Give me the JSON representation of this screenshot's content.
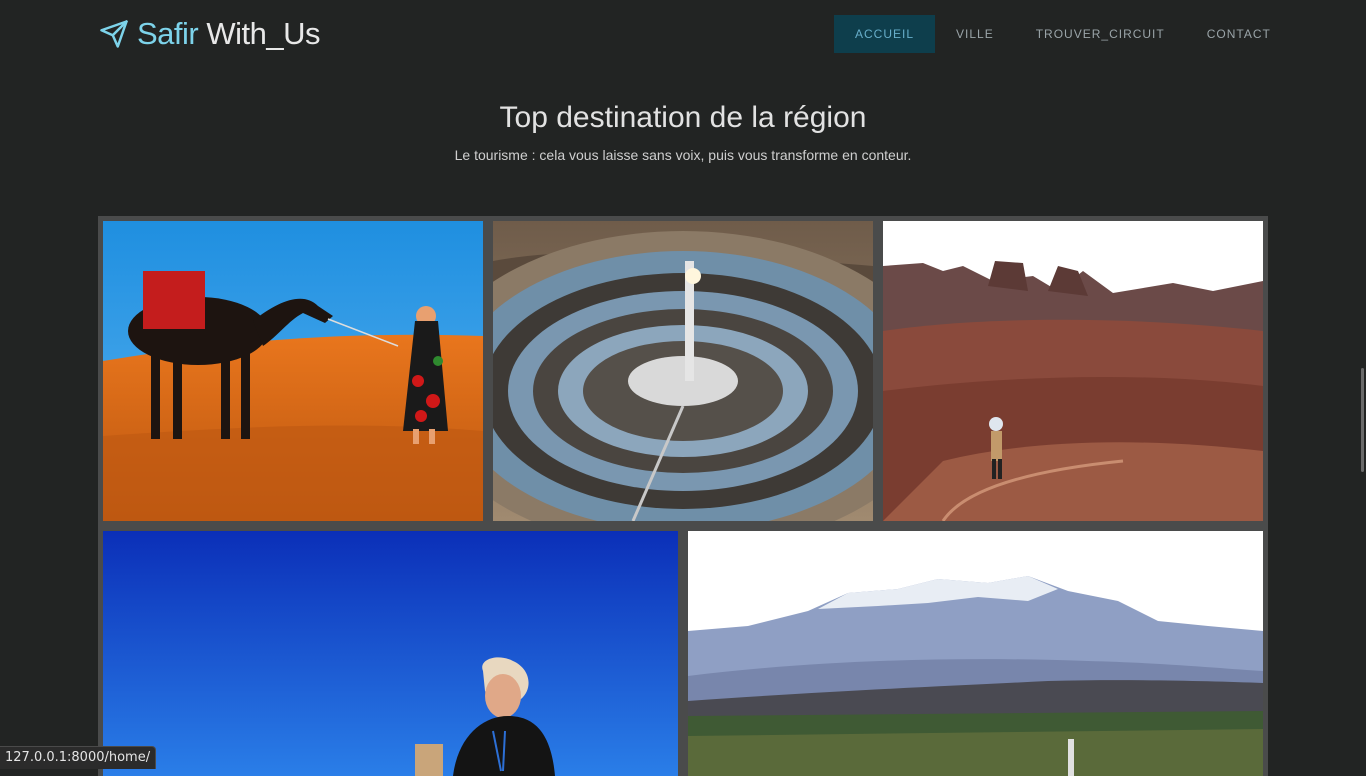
{
  "brand": {
    "accent": "Safir",
    "rest": " With_Us",
    "icon": "paper-plane-icon"
  },
  "nav": {
    "items": [
      {
        "label": "ACCUEIL",
        "active": true
      },
      {
        "label": "VILLE",
        "active": false
      },
      {
        "label": "TROUVER_CIRCUIT",
        "active": false
      },
      {
        "label": "CONTACT",
        "active": false
      }
    ]
  },
  "hero": {
    "title": "Top destination de la région",
    "subtitle": "Le tourisme : cela vous laisse sans voix, puis vous transforme en conteur."
  },
  "gallery": {
    "photos": [
      "desert-camel",
      "solar-tower",
      "red-rock-canyon",
      "woman-blue-sky",
      "atlas-mountains"
    ]
  },
  "status_url": "127.0.0.1:8000/home/",
  "colors": {
    "background": "#222423",
    "accent": "#7dd3ea",
    "nav_active_bg": "#0e3e4c",
    "gallery_frame": "#4a4b4b"
  }
}
